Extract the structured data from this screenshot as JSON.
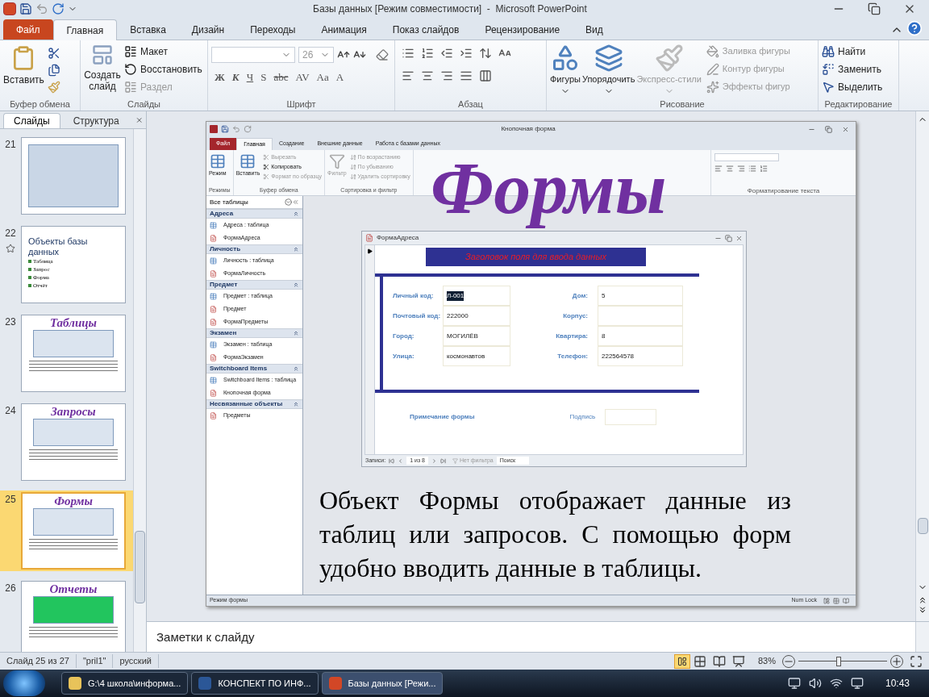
{
  "window": {
    "title": "Базы данных [Режим совместимости]  -  Microsoft PowerPoint"
  },
  "tabs": [
    {
      "label": "Файл",
      "kind": "file",
      "selected": false
    },
    {
      "label": "Главная",
      "kind": "tab",
      "selected": true
    },
    {
      "label": "Вставка",
      "kind": "tab",
      "selected": false
    },
    {
      "label": "Дизайн",
      "kind": "tab",
      "selected": false
    },
    {
      "label": "Переходы",
      "kind": "tab",
      "selected": false
    },
    {
      "label": "Анимация",
      "kind": "tab",
      "selected": false
    },
    {
      "label": "Показ слайдов",
      "kind": "tab",
      "selected": false
    },
    {
      "label": "Рецензирование",
      "kind": "tab",
      "selected": false
    },
    {
      "label": "Вид",
      "kind": "tab",
      "selected": false
    }
  ],
  "ribbon": {
    "clipboard": {
      "label": "Буфер обмена",
      "paste": "Вставить"
    },
    "slides": {
      "label": "Слайды",
      "new_slide": "Создать слайд",
      "items": [
        {
          "label": "Макет",
          "disabled": false
        },
        {
          "label": "Восстановить",
          "disabled": false
        },
        {
          "label": "Раздел",
          "disabled": true
        }
      ]
    },
    "font": {
      "label": "Шрифт",
      "size": "26",
      "buttons": [
        "Ж",
        "К",
        "Ч",
        "S",
        "abc",
        "AV",
        "Aa",
        "A"
      ]
    },
    "paragraph": {
      "label": "Абзац"
    },
    "drawing": {
      "label": "Рисование",
      "big": [
        {
          "label": "Фигуры",
          "disabled": false
        },
        {
          "label": "Упорядочить",
          "disabled": false
        },
        {
          "label": "Экспресс-стили",
          "disabled": true
        }
      ],
      "small": [
        {
          "label": "Заливка фигуры",
          "disabled": true
        },
        {
          "label": "Контур фигуры",
          "disabled": true
        },
        {
          "label": "Эффекты фигур",
          "disabled": true
        }
      ]
    },
    "editing": {
      "label": "Редактирование",
      "items": [
        "Найти",
        "Заменить",
        "Выделить"
      ]
    }
  },
  "slides_pane": {
    "tabs": [
      {
        "label": "Слайды",
        "selected": true
      },
      {
        "label": "Структура",
        "selected": false
      }
    ],
    "thumbnails": [
      {
        "number": "21",
        "kind": "screenshot",
        "selected": false,
        "animated": false
      },
      {
        "number": "22",
        "kind": "bullets",
        "selected": false,
        "animated": true,
        "title": "Объекты базы данных",
        "bullets": [
          "Таблица",
          "Запрос",
          "Форма",
          "Отчёт"
        ]
      },
      {
        "number": "23",
        "kind": "titled",
        "selected": false,
        "animated": false,
        "title": "Таблицы"
      },
      {
        "number": "24",
        "kind": "titled",
        "selected": false,
        "animated": false,
        "title": "Запросы"
      },
      {
        "number": "25",
        "kind": "titled",
        "selected": true,
        "animated": false,
        "title": "Формы"
      },
      {
        "number": "26",
        "kind": "titled",
        "selected": false,
        "animated": false,
        "title": "Отчеты"
      }
    ]
  },
  "slide": {
    "title": "Формы",
    "body": "Объект Формы отображает данные из таблиц или запросов. С помощью форм удобно вводить данные в таблицы.",
    "access": {
      "title": "Кнопочная форма",
      "tabs": [
        {
          "label": "Файл",
          "kind": "file",
          "selected": false
        },
        {
          "label": "Главная",
          "kind": "tab",
          "selected": true
        },
        {
          "label": "Создание",
          "kind": "tab",
          "selected": false
        },
        {
          "label": "Внешние данные",
          "kind": "tab",
          "selected": false
        },
        {
          "label": "Работа с базами данных",
          "kind": "tab",
          "selected": false
        }
      ],
      "ribbon_groups": [
        {
          "label": "Режимы",
          "items": [
            {
              "label": "Режим",
              "kind": "large",
              "disabled": false
            }
          ]
        },
        {
          "label": "Буфер обмена",
          "items": [
            {
              "label": "Вставить",
              "kind": "large",
              "disabled": false
            },
            {
              "label": "Вырезать",
              "kind": "small",
              "disabled": true
            },
            {
              "label": "Копировать",
              "kind": "small",
              "disabled": false
            },
            {
              "label": "Формат по образцу",
              "kind": "small",
              "disabled": true
            }
          ]
        },
        {
          "label": "Сортировка и фильтр",
          "items": [
            {
              "label": "Фильтр",
              "kind": "large",
              "disabled": true
            },
            {
              "label": "По возрастанию",
              "kind": "small",
              "disabled": true
            },
            {
              "label": "По убыванию",
              "kind": "small",
              "disabled": true
            },
            {
              "label": "Удалить сортировку",
              "kind": "small",
              "disabled": true
            }
          ]
        }
      ],
      "text_group": "Форматирование текста",
      "nav": {
        "header": "Все таблицы",
        "groups": [
          {
            "label": "Адреса",
            "items": [
              {
                "label": "Адреса : таблица",
                "kind": "table"
              },
              {
                "label": "ФормаАдреса",
                "kind": "form"
              }
            ]
          },
          {
            "label": "Личность",
            "items": [
              {
                "label": "Личность : таблица",
                "kind": "table"
              },
              {
                "label": "ФормаЛичность",
                "kind": "form"
              }
            ]
          },
          {
            "label": "Предмет",
            "items": [
              {
                "label": "Предмет : таблица",
                "kind": "table"
              },
              {
                "label": "Предмет",
                "kind": "form"
              },
              {
                "label": "ФормаПредметы",
                "kind": "form"
              }
            ]
          },
          {
            "label": "Экзамен",
            "items": [
              {
                "label": "Экзамен : таблица",
                "kind": "table"
              },
              {
                "label": "ФормаЭкзамен",
                "kind": "form"
              }
            ]
          },
          {
            "label": "Switchboard Items",
            "items": [
              {
                "label": "Switchboard Items : таблица",
                "kind": "table"
              },
              {
                "label": "Кнопочная форма",
                "kind": "form"
              }
            ]
          },
          {
            "label": "Несвязанные объекты",
            "items": [
              {
                "label": "Предметы",
                "kind": "form"
              }
            ]
          }
        ]
      },
      "form": {
        "title": "ФормаАдреса",
        "heading": "Заголовок поля для ввода данных",
        "left_fields": [
          {
            "label": "Личный код:",
            "value": "Л-001",
            "selected": true
          },
          {
            "label": "Почтовый код:",
            "value": "222000",
            "selected": false
          },
          {
            "label": "Город:",
            "value": "МОГИЛЁВ",
            "selected": false
          },
          {
            "label": "Улица:",
            "value": "космонавтов",
            "selected": false
          }
        ],
        "right_fields": [
          {
            "label": "Дом:",
            "value": "5",
            "selected": false
          },
          {
            "label": "Корпус:",
            "selected": false
          },
          {
            "label": "Квартира:",
            "value": "8",
            "selected": false
          },
          {
            "label": "Телефон:",
            "value": "222564578",
            "selected": false
          }
        ],
        "footer_note": "Примечание формы",
        "signature": "Подпись",
        "navigator": {
          "label": "Записи:",
          "position": "1 из 8",
          "filter": "Нет фильтра",
          "search_placeholder": "Поиск"
        }
      },
      "status": {
        "mode": "Режим формы",
        "num_lock": "Num Lock"
      }
    }
  },
  "notes": {
    "placeholder": "Заметки к слайду"
  },
  "status_bar": {
    "slide": "Слайд 25 из 27",
    "theme": "\"pril1\"",
    "language": "русский",
    "zoom": "83%",
    "zoom_slider": {
      "level": 0.45
    }
  },
  "taskbar": {
    "items": [
      {
        "label": "G:\\4 школа\\информа...",
        "kind": "folder",
        "selected": false
      },
      {
        "label": "КОНСПЕКТ ПО ИНФ...",
        "kind": "word",
        "selected": false
      },
      {
        "label": "Базы данных [Режи...",
        "kind": "powerpoint",
        "selected": true
      }
    ],
    "clock": "10:43"
  }
}
